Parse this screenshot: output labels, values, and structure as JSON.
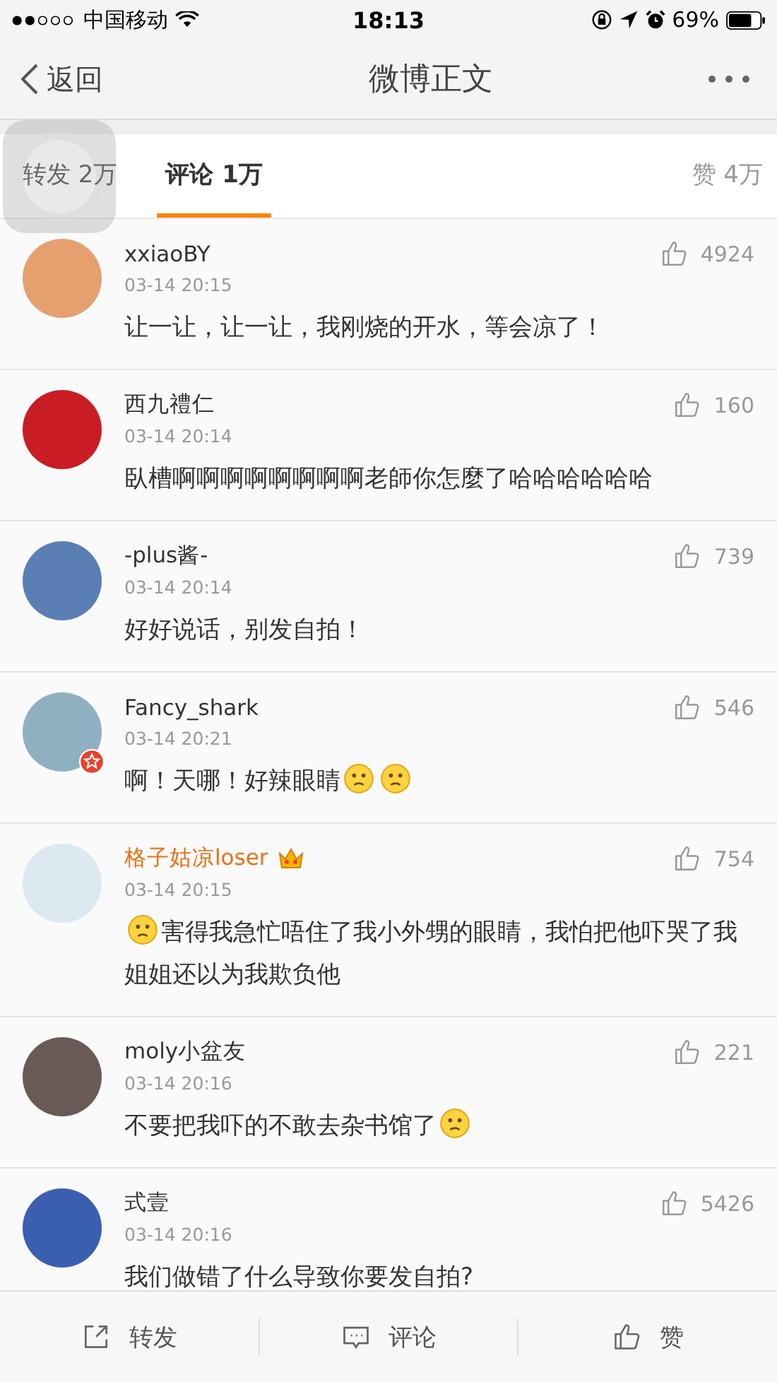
{
  "status_bar": {
    "carrier": "中国移动",
    "time": "18:13",
    "battery": "69%"
  },
  "nav": {
    "back": "返回",
    "title": "微博正文"
  },
  "tabs": [
    {
      "label": "转发 2万",
      "selected": false
    },
    {
      "label": "评论 1万",
      "selected": true
    }
  ],
  "likes_tab": "赞 4万",
  "comments": [
    {
      "user": "xxiaoBY",
      "vip": false,
      "verified": false,
      "likes": "4924",
      "time": "03-14 20:15",
      "body": [
        {
          "kind": "text",
          "text": "让一让，让一让，我刚烧的开水，等会凉了！"
        }
      ]
    },
    {
      "user": "西九禮仁",
      "vip": false,
      "verified": false,
      "likes": "160",
      "time": "03-14 20:14",
      "body": [
        {
          "kind": "text",
          "text": "臥槽啊啊啊啊啊啊啊啊老師你怎麼了哈哈哈哈哈哈"
        }
      ]
    },
    {
      "user": "-plus酱-",
      "vip": false,
      "verified": false,
      "likes": "739",
      "time": "03-14 20:14",
      "body": [
        {
          "kind": "text",
          "text": "好好说话，别发自拍！"
        }
      ]
    },
    {
      "user": "Fancy_shark",
      "vip": false,
      "verified": true,
      "likes": "546",
      "time": "03-14 20:21",
      "body": [
        {
          "kind": "text",
          "text": "啊！天哪！好辣眼睛"
        },
        {
          "kind": "emoji"
        },
        {
          "kind": "emoji"
        }
      ]
    },
    {
      "user": "格子姑凉loser",
      "vip": true,
      "verified": false,
      "likes": "754",
      "time": "03-14 20:15",
      "body": [
        {
          "kind": "emoji"
        },
        {
          "kind": "text",
          "text": "害得我急忙唔住了我小外甥的眼睛，我怕把他吓哭了我姐姐还以为我欺负他"
        }
      ]
    },
    {
      "user": "moly小盆友",
      "vip": false,
      "verified": false,
      "likes": "221",
      "time": "03-14 20:16",
      "body": [
        {
          "kind": "text",
          "text": "不要把我吓的不敢去杂书馆了"
        },
        {
          "kind": "emoji"
        }
      ]
    },
    {
      "user": "式壹",
      "vip": false,
      "verified": false,
      "likes": "5426",
      "time": "03-14 20:16",
      "body": [
        {
          "kind": "text",
          "text": "我们做错了什么导致你要发自拍?"
        }
      ]
    }
  ],
  "actions": [
    {
      "kind": "share",
      "label": "转发"
    },
    {
      "kind": "comment",
      "label": "评论"
    },
    {
      "kind": "like",
      "label": "赞"
    }
  ]
}
